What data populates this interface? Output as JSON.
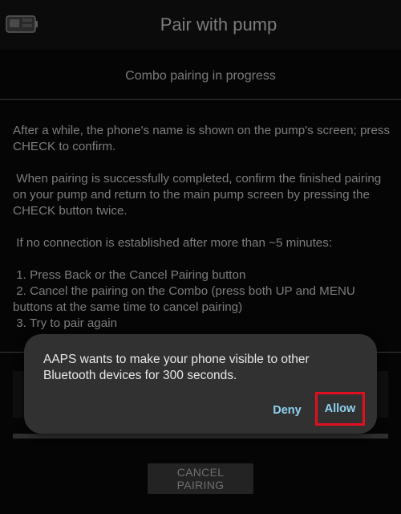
{
  "app_bar": {
    "title": "Pair with pump",
    "icon": "pump-icon"
  },
  "subheader": "Combo pairing in progress",
  "instructions": "After a while, the phone's name is shown on the pump's screen; press CHECK to confirm.\n\n When pairing is successfully completed, confirm the finished pairing on your pump and return to the main pump screen by pressing the CHECK button twice.\n\n If no connection is established after more than ~5 minutes:\n\n 1. Press Back or the Cancel Pairing button\n 2. Cancel the pairing on the Combo (press both UP and MENU buttons at the same time to cancel pairing)\n 3. Try to pair again",
  "cancel_button": "CANCEL PAIRING",
  "dialog": {
    "message": "AAPS wants to make your phone visible to other Bluetooth devices for 300 seconds.",
    "deny_label": "Deny",
    "allow_label": "Allow",
    "highlight_color": "#e01020",
    "button_color": "#8fd2f0"
  }
}
